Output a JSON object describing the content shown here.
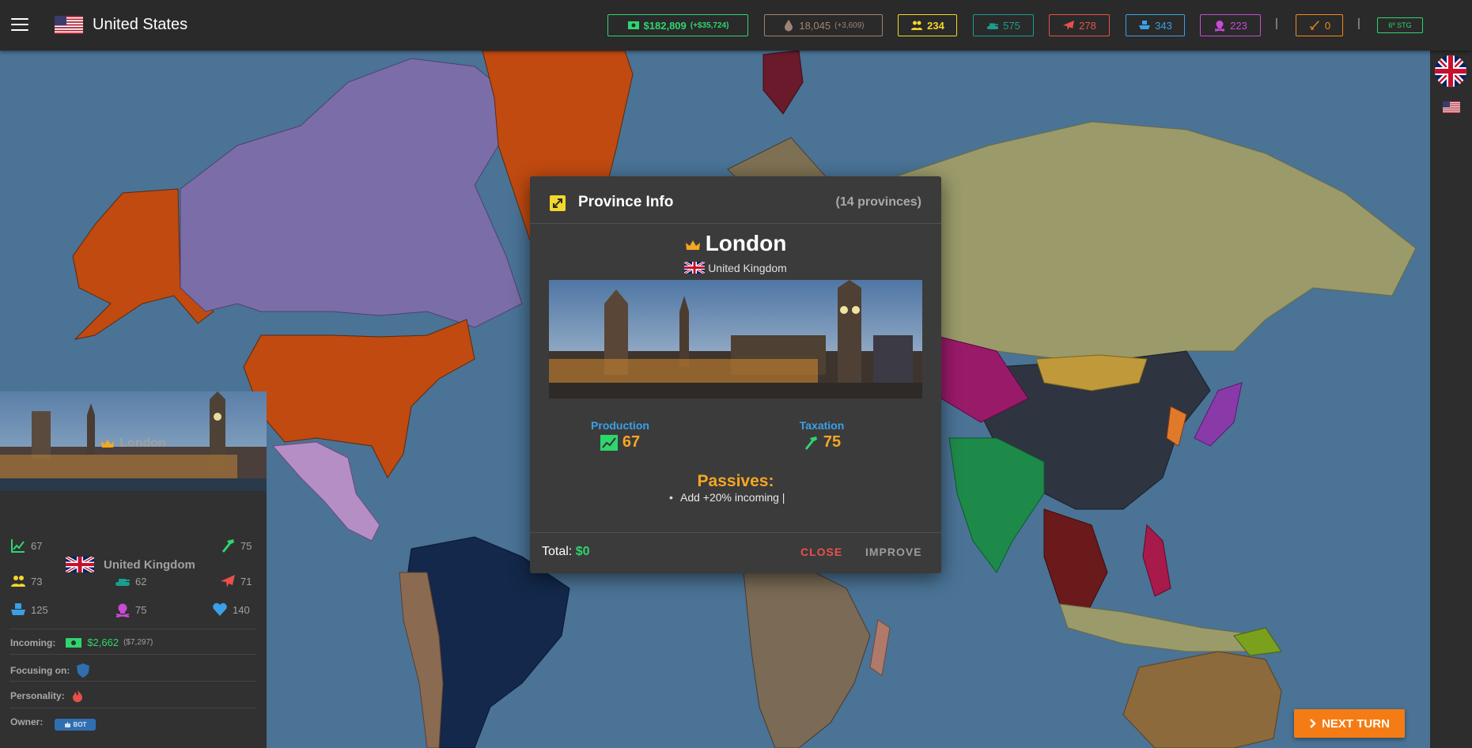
{
  "header": {
    "nation": "United States",
    "resources": {
      "money": {
        "value": "$182,809",
        "change": "(+$35,724)",
        "color": "#2ed66e"
      },
      "oil": {
        "value": "18,045",
        "change": "(+3,609)",
        "color": "#9e8474"
      },
      "manpower": {
        "value": "234",
        "color": "#f3d72a"
      },
      "tanks": {
        "value": "575",
        "color": "#1a9e8e"
      },
      "aircraft": {
        "value": "278",
        "color": "#e8504b"
      },
      "ships": {
        "value": "343",
        "color": "#3aa0e8"
      },
      "nukes": {
        "value": "223",
        "color": "#c94bd6"
      },
      "missiles": {
        "value": "0",
        "color": "#f08a1c"
      },
      "stage": {
        "value": "6º STG",
        "color": "#2ed66e"
      }
    },
    "separator": "|"
  },
  "modal": {
    "title": "Province Info",
    "count": "(14 provinces)",
    "province": "London",
    "country": "United Kingdom",
    "production_label": "Production",
    "production_value": "67",
    "taxation_label": "Taxation",
    "taxation_value": "75",
    "passives_title": "Passives:",
    "passive_item": "Add +20% incoming |",
    "total_label": "Total:",
    "total_value": "$0",
    "close_label": "CLOSE",
    "improve_label": "IMPROVE"
  },
  "left_panel": {
    "province": "London",
    "production": "67",
    "taxation": "75",
    "country": "United Kingdom",
    "manpower": "73",
    "tanks": "62",
    "aircraft": "71",
    "ships": "125",
    "nukes": "75",
    "health": "140",
    "incoming_label": "Incoming:",
    "incoming_value": "$2,662",
    "incoming_sub": "($7,297)",
    "focus_label": "Focusing on:",
    "personality_label": "Personality:",
    "owner_label": "Owner:",
    "owner_badge": "BOT"
  },
  "next_turn": {
    "label": "NEXT TURN",
    "color": "#f57c14"
  },
  "colors": {
    "ocean": "#4a7396",
    "usa": "#c04a10",
    "canada": "#7b6ea8",
    "russia": "#9a9a6a",
    "china": "#2e3440",
    "africa": "#7a6a56",
    "australia": "#8c6a3c"
  }
}
